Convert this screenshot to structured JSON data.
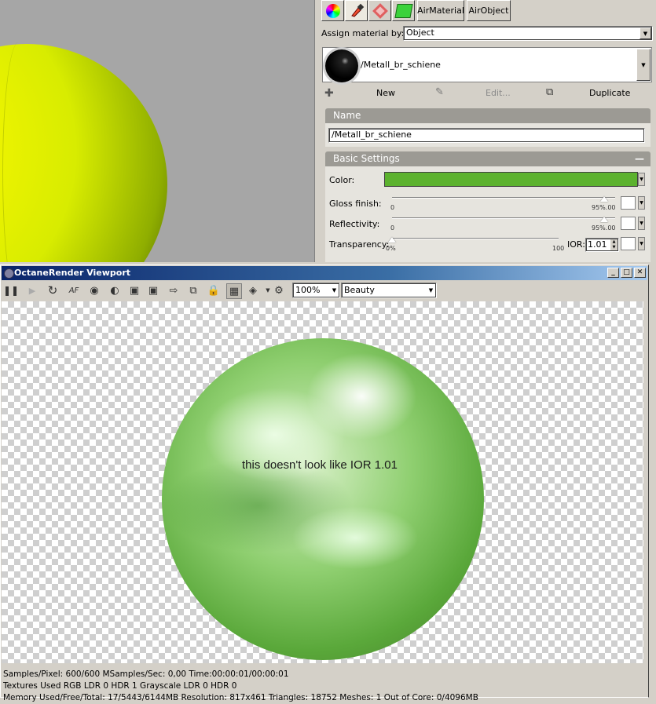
{
  "material_panel": {
    "toolbar": {
      "airmaterial_label": "AirMaterial",
      "airobject_label": "AirObject"
    },
    "assign_label": "Assign material by:",
    "assign_value": "Object",
    "material_name": "/Metall_br_schiene",
    "actions": {
      "new_label": "New",
      "edit_label": "Edit...",
      "duplicate_label": "Duplicate"
    },
    "name_section": {
      "title": "Name",
      "value": "/Metall_br_schiene"
    },
    "basic_settings": {
      "title": "Basic Settings",
      "collapse_symbol": "—",
      "color_label": "Color:",
      "color_value": "#5cb22e",
      "gloss_label": "Gloss finish:",
      "gloss_min": "0",
      "gloss_value": "95%.00",
      "gloss_fraction": 0.95,
      "reflectivity_label": "Reflectivity:",
      "reflectivity_min": "0",
      "reflectivity_value": "95%.00",
      "reflectivity_fraction": 0.95,
      "transparency_label": "Transparency:",
      "transparency_value": "0%",
      "transparency_max": "100",
      "transparency_fraction": 0.0,
      "ior_label": "IOR:",
      "ior_value": "1.01"
    }
  },
  "octane_window": {
    "title": "OctaneRender Viewport",
    "zoom_value": "100%",
    "render_pass": "Beauty",
    "annotation": "this doesn't look like IOR 1.01",
    "status_lines": [
      "Samples/Pixel: 600/600  MSamples/Sec: 0,00  Time:00:00:01/00:00:01",
      "Textures Used RGB LDR 0  HDR 1  Grayscale LDR 0  HDR 0",
      "Memory Used/Free/Total: 17/5443/6144MB  Resolution: 817x461  Triangles: 18752  Meshes: 1 Out of Core: 0/4096MB"
    ]
  }
}
